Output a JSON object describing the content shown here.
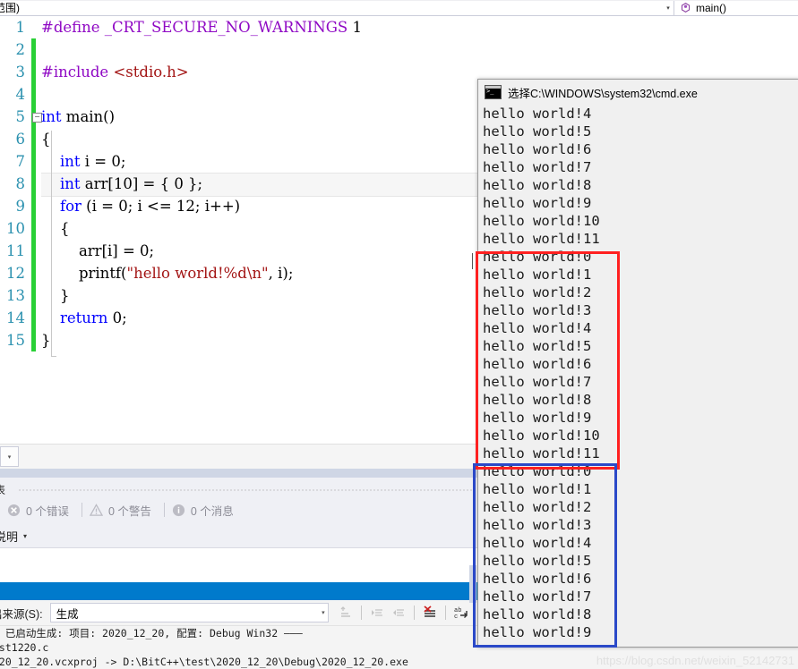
{
  "navbar": {
    "scope_text": "范围)",
    "scope_caret": "▾",
    "member_icon": "method-icon",
    "member_text": "main()"
  },
  "editor": {
    "lines": [
      {
        "num": "1",
        "indent": 0,
        "changed": false,
        "highlight": false,
        "tokens": [
          {
            "t": "#define ",
            "c": "pp"
          },
          {
            "t": "_CRT_SECURE_NO_WARNINGS",
            "c": "ppid"
          },
          {
            "t": " 1",
            "c": "pln"
          }
        ]
      },
      {
        "num": "2",
        "indent": 0,
        "changed": true,
        "highlight": false,
        "tokens": []
      },
      {
        "num": "3",
        "indent": 0,
        "changed": true,
        "highlight": false,
        "tokens": [
          {
            "t": "#include ",
            "c": "pp"
          },
          {
            "t": "<stdio.h>",
            "c": "inc"
          }
        ]
      },
      {
        "num": "4",
        "indent": 0,
        "changed": true,
        "highlight": false,
        "tokens": []
      },
      {
        "num": "5",
        "indent": 0,
        "changed": true,
        "highlight": false,
        "tokens": [
          {
            "t": "int",
            "c": "kw"
          },
          {
            "t": " main()",
            "c": "pln"
          }
        ]
      },
      {
        "num": "6",
        "indent": 0,
        "changed": true,
        "highlight": false,
        "tokens": [
          {
            "t": "{",
            "c": "pln"
          }
        ]
      },
      {
        "num": "7",
        "indent": 0,
        "changed": true,
        "highlight": false,
        "tokens": [
          {
            "t": "    ",
            "c": "pln"
          },
          {
            "t": "int",
            "c": "kw"
          },
          {
            "t": " i = 0;",
            "c": "pln"
          }
        ]
      },
      {
        "num": "8",
        "indent": 0,
        "changed": true,
        "highlight": true,
        "tokens": [
          {
            "t": "    ",
            "c": "pln"
          },
          {
            "t": "int",
            "c": "kw"
          },
          {
            "t": " arr[10] = { 0 };",
            "c": "pln"
          }
        ]
      },
      {
        "num": "9",
        "indent": 0,
        "changed": true,
        "highlight": false,
        "tokens": [
          {
            "t": "    ",
            "c": "pln"
          },
          {
            "t": "for",
            "c": "kw"
          },
          {
            "t": " (i = 0; i <= 12; i++)",
            "c": "pln"
          }
        ]
      },
      {
        "num": "10",
        "indent": 0,
        "changed": true,
        "highlight": false,
        "tokens": [
          {
            "t": "    {",
            "c": "pln"
          }
        ]
      },
      {
        "num": "11",
        "indent": 0,
        "changed": true,
        "highlight": false,
        "tokens": [
          {
            "t": "        arr[i] = 0;",
            "c": "pln"
          }
        ]
      },
      {
        "num": "12",
        "indent": 0,
        "changed": true,
        "highlight": false,
        "tokens": [
          {
            "t": "        printf(",
            "c": "pln"
          },
          {
            "t": "\"hello world!%d\\n\"",
            "c": "str"
          },
          {
            "t": ", i);",
            "c": "pln"
          }
        ]
      },
      {
        "num": "13",
        "indent": 0,
        "changed": true,
        "highlight": false,
        "tokens": [
          {
            "t": "    }",
            "c": "pln"
          }
        ]
      },
      {
        "num": "14",
        "indent": 0,
        "changed": true,
        "highlight": false,
        "tokens": [
          {
            "t": "    ",
            "c": "pln"
          },
          {
            "t": "return",
            "c": "kw"
          },
          {
            "t": " 0;",
            "c": "pln"
          }
        ]
      },
      {
        "num": "15",
        "indent": 0,
        "changed": true,
        "highlight": false,
        "tokens": [
          {
            "t": "}",
            "c": "pln"
          }
        ]
      }
    ],
    "fold_glyph": "−"
  },
  "error_list": {
    "title": "表",
    "errors_label": "0 个错误",
    "warnings_label": "0 个警告",
    "messages_label": "0 个消息",
    "column_header": "说明",
    "column_caret": "▾"
  },
  "output": {
    "source_label": "出来源(S):",
    "source_value": "生成",
    "source_caret": "▾",
    "tool_icons": [
      "go-to-message-icon",
      "previous-message-icon",
      "next-message-icon",
      "clear-all-icon",
      "toggle-word-wrap-icon"
    ],
    "text": "— 已启动生成: 项目: 2020_12_20, 配置: Debug Win32 ———\nest1220.c\n020_12_20.vcxproj -> D:\\BitC++\\test\\2020_12_20\\Debug\\2020_12_20.exe"
  },
  "console": {
    "icon": "cmd-icon",
    "title": "选择C:\\WINDOWS\\system32\\cmd.exe",
    "lines_before": [
      "hello world!4",
      "hello world!5",
      "hello world!6",
      "hello world!7",
      "hello world!8",
      "hello world!9",
      "hello world!10",
      "hello world!11"
    ],
    "red_box_lines": [
      "hello world!0",
      "hello world!1",
      "hello world!2",
      "hello world!3",
      "hello world!4",
      "hello world!5",
      "hello world!6",
      "hello world!7",
      "hello world!8",
      "hello world!9",
      "hello world!10",
      "hello world!11"
    ],
    "blue_box_lines": [
      "hello world!0",
      "hello world!1",
      "hello world!2",
      "hello world!3",
      "hello world!4",
      "hello world!5",
      "hello world!6",
      "hello world!7",
      "hello world!8",
      "hello world!9"
    ]
  },
  "annotations": {
    "red_box_color": "#ff2020",
    "blue_box_color": "#2b49c8"
  },
  "watermark": {
    "text": "https://blog.csdn.net/weixin_52142731"
  }
}
